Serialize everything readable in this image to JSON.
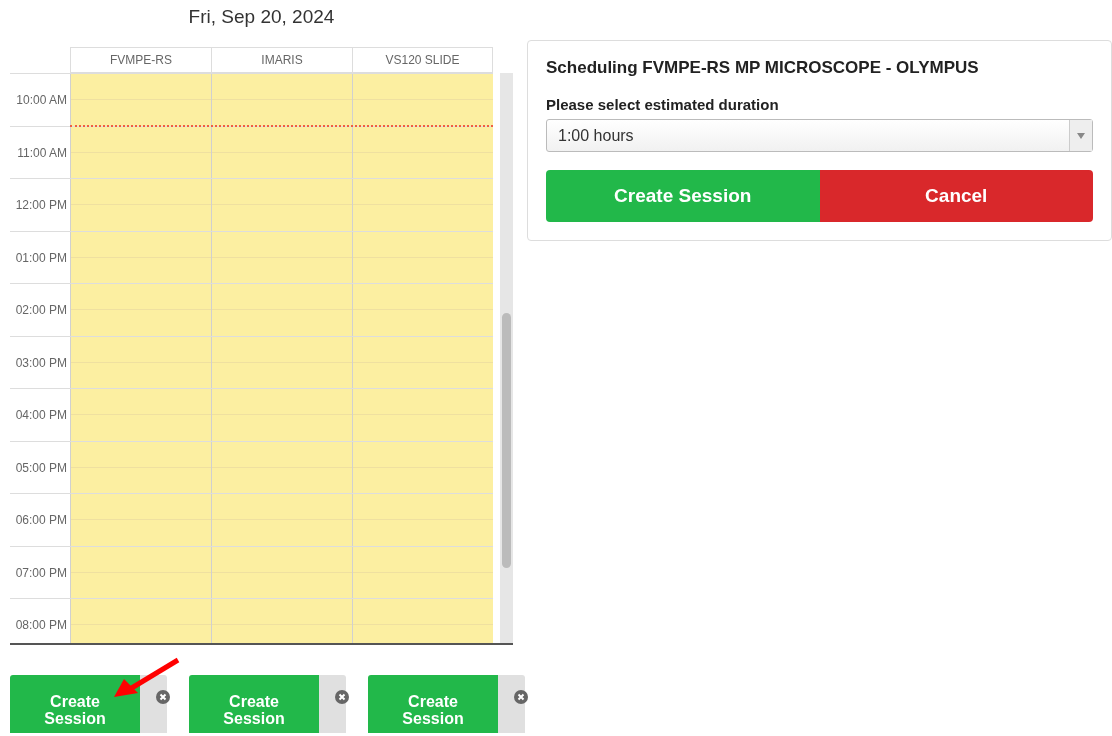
{
  "date": "Fri, Sep 20, 2024",
  "calendar": {
    "columns": [
      "FVMPE-RS",
      "IMARIS",
      "VS120 SLIDE"
    ],
    "times": [
      "10:00 AM",
      "11:00 AM",
      "12:00 PM",
      "01:00 PM",
      "02:00 PM",
      "03:00 PM",
      "04:00 PM",
      "05:00 PM",
      "06:00 PM",
      "07:00 PM",
      "08:00 PM"
    ]
  },
  "session_buttons": [
    {
      "label": "Create Session"
    },
    {
      "label": "Create Session"
    },
    {
      "label": "Create Session"
    }
  ],
  "panel": {
    "title": "Scheduling FVMPE-RS MP MICROSCOPE - OLYMPUS",
    "duration_label": "Please select estimated duration",
    "duration": "1:00 hours",
    "create_button": "Create Session",
    "cancel_button": "Cancel"
  }
}
